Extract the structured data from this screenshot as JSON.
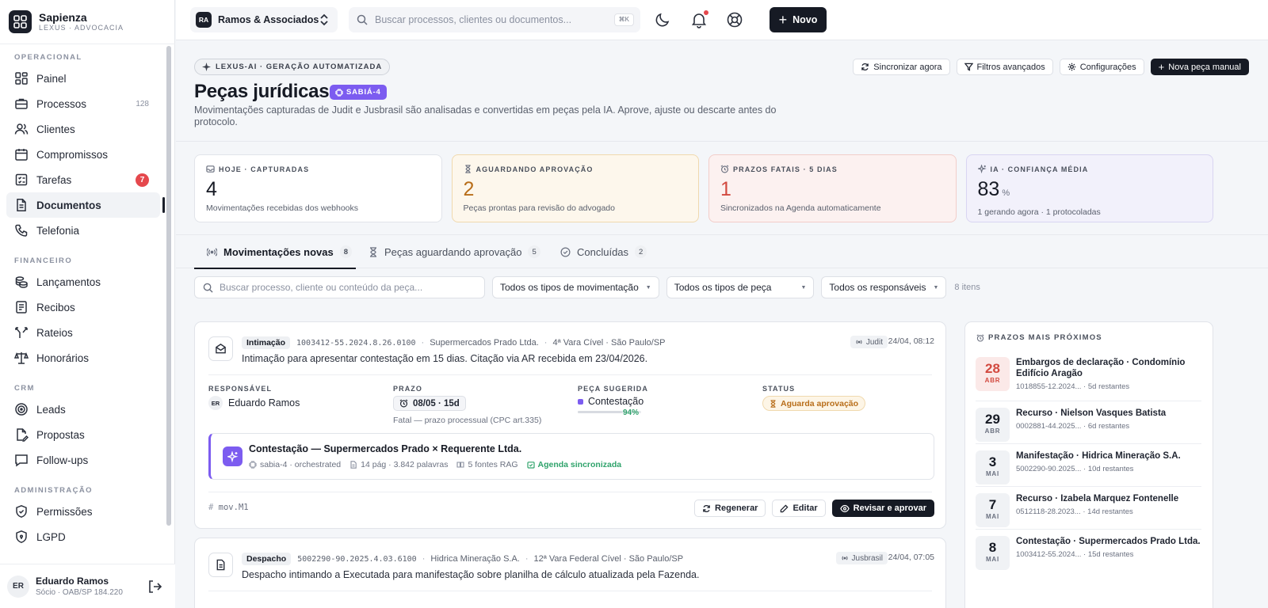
{
  "brand": {
    "name": "Sapienza",
    "sub": "LEXUS · ADVOCACIA"
  },
  "nav": {
    "sections": [
      {
        "title": "OPERACIONAL",
        "items": [
          {
            "label": "Painel",
            "icon": "grid-icon"
          },
          {
            "label": "Processos",
            "icon": "briefcase-icon",
            "count": "128"
          },
          {
            "label": "Clientes",
            "icon": "users-icon"
          },
          {
            "label": "Compromissos",
            "icon": "calendar-icon"
          },
          {
            "label": "Tarefas",
            "icon": "checklist-icon",
            "badge": "7"
          },
          {
            "label": "Documentos",
            "icon": "document-icon",
            "active": true
          },
          {
            "label": "Telefonia",
            "icon": "phone-icon"
          }
        ]
      },
      {
        "title": "FINANCEIRO",
        "items": [
          {
            "label": "Lançamentos",
            "icon": "coins-icon"
          },
          {
            "label": "Recibos",
            "icon": "receipt-icon"
          },
          {
            "label": "Rateios",
            "icon": "split-icon"
          },
          {
            "label": "Honorários",
            "icon": "scale-icon"
          }
        ]
      },
      {
        "title": "CRM",
        "items": [
          {
            "label": "Leads",
            "icon": "target-icon"
          },
          {
            "label": "Propostas",
            "icon": "file-edit-icon"
          },
          {
            "label": "Follow-ups",
            "icon": "chat-icon"
          }
        ]
      },
      {
        "title": "ADMINISTRAÇÃO",
        "items": [
          {
            "label": "Permissões",
            "icon": "shield-icon"
          },
          {
            "label": "LGPD",
            "icon": "lock-icon"
          }
        ]
      }
    ]
  },
  "user": {
    "initials": "ER",
    "name": "Eduardo Ramos",
    "role": "Sócio · OAB/SP 184.220"
  },
  "topbar": {
    "org_initials": "RA",
    "org_name": "Ramos & Associados",
    "search_placeholder": "Buscar processos, clientes ou documentos...",
    "search_kbd": "⌘K",
    "new_label": "Novo"
  },
  "header": {
    "pill": "LEXUS-AI · GERAÇÃO AUTOMATIZADA",
    "title": "Peças jurídicas",
    "model_badge": "SABIÁ-4",
    "description": "Movimentações capturadas de Judit e Jusbrasil são analisadas e convertidas em peças pela IA. Aprove, ajuste ou descarte antes do protocolo.",
    "actions": [
      "Sincronizar agora",
      "Filtros avançados",
      "Configurações",
      "Nova peça manual"
    ]
  },
  "stats": [
    {
      "label": "HOJE · CAPTURADAS",
      "value": "4",
      "unit": "",
      "sub": "Movimentações recebidas dos webhooks",
      "tone": "plain",
      "icon": "inbox-icon"
    },
    {
      "label": "AGUARDANDO APROVAÇÃO",
      "value": "2",
      "unit": "",
      "sub": "Peças prontas para revisão do advogado",
      "tone": "amber",
      "icon": "hourglass-icon"
    },
    {
      "label": "PRAZOS FATAIS · 5 DIAS",
      "value": "1",
      "unit": "",
      "sub": "Sincronizados na Agenda automaticamente",
      "tone": "red",
      "icon": "alarm-icon"
    },
    {
      "label": "IA · CONFIANÇA MÉDIA",
      "value": "83",
      "unit": "%",
      "sub": "1 gerando agora · 1 protocoladas",
      "tone": "purple",
      "icon": "sparkle-icon"
    }
  ],
  "tabs": [
    {
      "label": "Movimentações novas",
      "count": "8",
      "active": true
    },
    {
      "label": "Peças aguardando aprovação",
      "count": "5"
    },
    {
      "label": "Concluídas",
      "count": "2"
    }
  ],
  "filters": {
    "search_placeholder": "Buscar processo, cliente ou conteúdo da peça...",
    "selects": [
      "Todos os tipos de movimentação",
      "Todos os tipos de peça",
      "Todos os responsáveis"
    ],
    "count": "8 itens"
  },
  "cards": [
    {
      "type": "Intimação",
      "number": "1003412-55.2024.8.26.0100",
      "client": "Supermercados Prado Ltda.",
      "court": "4ª Vara Cível · São Paulo/SP",
      "source": "Judit",
      "time": "24/04, 08:12",
      "text": "Intimação para apresentar contestação em 15 dias. Citação via AR recebida em 23/04/2026.",
      "labels": {
        "resp": "RESPONSÁVEL",
        "prazo": "PRAZO",
        "peca": "PEÇA SUGERIDA",
        "status": "STATUS"
      },
      "resp_initials": "ER",
      "resp_name": "Eduardo Ramos",
      "prazo": "08/05 · 15d",
      "prazo_sub": "Fatal — prazo processual (CPC art.335)",
      "peca": "Contestação",
      "confidence": "94%",
      "confidence_value": 0.94,
      "status": "Aguarda aprovação",
      "gen": {
        "title": "Contestação — Supermercados Prado × Requerente Ltda.",
        "model": "sabia-4 · orchestrated",
        "pages": "14 pág · 3.842 palavras",
        "sources": "5 fontes RAG",
        "agenda": "Agenda sincronizada"
      },
      "foot_id": "mov.M1",
      "buttons": [
        "Regenerar",
        "Editar",
        "Revisar e aprovar"
      ]
    },
    {
      "type": "Despacho",
      "number": "5002290-90.2025.4.03.6100",
      "client": "Hidrica Mineração S.A.",
      "court": "12ª Vara Federal Cível · São Paulo/SP",
      "source": "Jusbrasil",
      "time": "24/04, 07:05",
      "text": "Despacho intimando a Executada para manifestação sobre planilha de cálculo atualizada pela Fazenda."
    }
  ],
  "deadlines": {
    "title": "PRAZOS MAIS PRÓXIMOS",
    "items": [
      {
        "day": "28",
        "month": "ABR",
        "hot": true,
        "title": "Embargos de declaração · Condomínio Edifício Aragão",
        "ref": "1018855-12.2024...",
        "rest": "5d restantes"
      },
      {
        "day": "29",
        "month": "ABR",
        "title": "Recurso · Nielson Vasques Batista",
        "ref": "0002881-44.2025...",
        "rest": "6d restantes"
      },
      {
        "day": "3",
        "month": "MAI",
        "title": "Manifestação · Hidrica Mineração S.A.",
        "ref": "5002290-90.2025...",
        "rest": "10d restantes"
      },
      {
        "day": "7",
        "month": "MAI",
        "title": "Recurso · Izabela Marquez Fontenelle",
        "ref": "0512118-28.2023...",
        "rest": "14d restantes"
      },
      {
        "day": "8",
        "month": "MAI",
        "title": "Contestação · Supermercados Prado Ltda.",
        "ref": "1003412-55.2024...",
        "rest": "15d restantes"
      }
    ]
  }
}
